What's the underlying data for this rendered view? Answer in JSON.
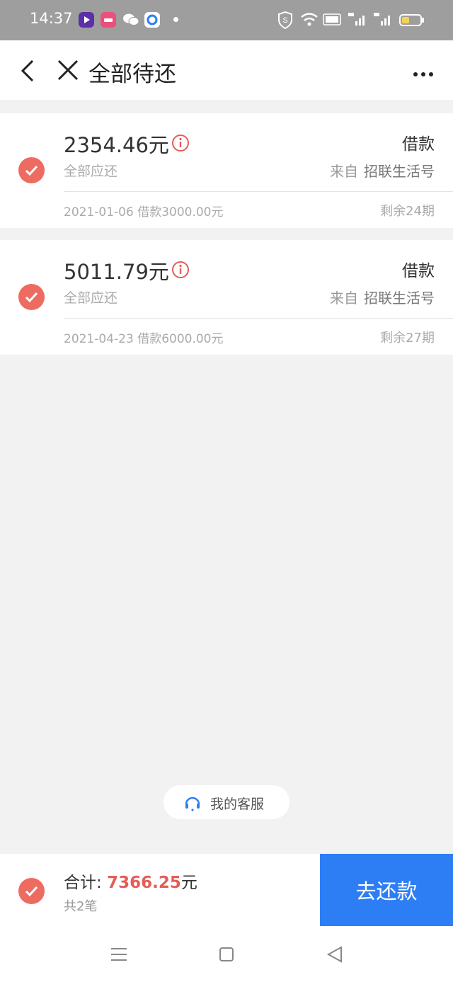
{
  "status_bar": {
    "time": "14:37"
  },
  "header": {
    "title": "全部待还"
  },
  "loans": [
    {
      "amount": "2354.46元",
      "type": "借款",
      "subtitle": "全部应还",
      "from_label": "来自",
      "from_name": "招联生活号",
      "date_info": "2021-01-06 借款3000.00元",
      "remaining": "剩余24期"
    },
    {
      "amount": "5011.79元",
      "type": "借款",
      "subtitle": "全部应还",
      "from_label": "来自",
      "from_name": "招联生活号",
      "date_info": "2021-04-23 借款6000.00元",
      "remaining": "剩余27期"
    }
  ],
  "customer_service": {
    "label": "我的客服"
  },
  "footer": {
    "total_label": "合计: ",
    "total_value": "7366.25",
    "total_unit": "元",
    "count": "共2笔",
    "pay_button": "去还款"
  },
  "colors": {
    "accent": "#2d7ef5",
    "check": "#ee6b61",
    "amount_red": "#e65c57"
  }
}
